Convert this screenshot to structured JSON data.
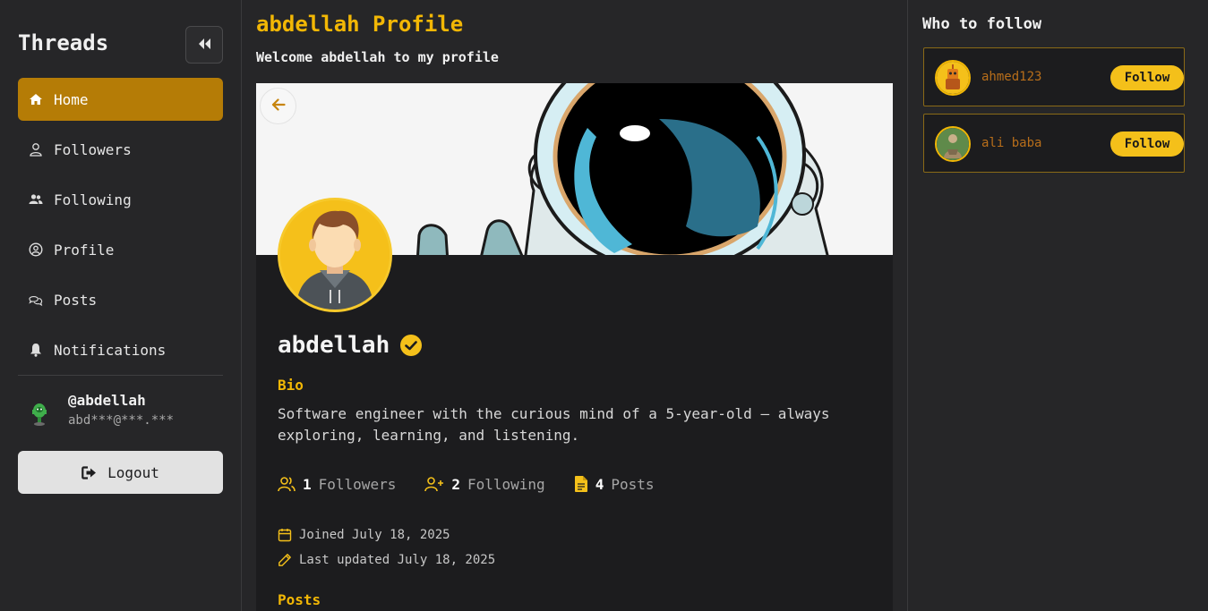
{
  "sidebar": {
    "brand": "Threads",
    "collapse_icon": "double-chevron-left-icon",
    "items": [
      {
        "label": "Home",
        "icon": "home-icon",
        "active": true
      },
      {
        "label": "Followers",
        "icon": "user-icon",
        "active": false
      },
      {
        "label": "Following",
        "icon": "users-icon",
        "active": false
      },
      {
        "label": "Profile",
        "icon": "user-circle-icon",
        "active": false
      },
      {
        "label": "Posts",
        "icon": "chat-icon",
        "active": false
      },
      {
        "label": "Notifications",
        "icon": "bell-icon",
        "active": false
      }
    ],
    "user": {
      "handle": "@abdellah",
      "email": "abd***@***.***"
    },
    "logout_label": "Logout"
  },
  "main": {
    "title": "abdellah Profile",
    "subtitle": "Welcome abdellah to my profile",
    "profile": {
      "name": "abdellah",
      "bio_label": "Bio",
      "bio": "Software engineer with the curious mind of a 5-year-old — always exploring, learning, and listening.",
      "stats": [
        {
          "value": "1",
          "label": "Followers",
          "icon": "users-icon"
        },
        {
          "value": "2",
          "label": "Following",
          "icon": "user-plus-icon"
        },
        {
          "value": "4",
          "label": "Posts",
          "icon": "document-icon"
        }
      ],
      "joined": "Joined July 18, 2025",
      "updated": "Last updated July 18, 2025",
      "posts_heading": "Posts"
    }
  },
  "right": {
    "title": "Who to follow",
    "suggestions": [
      {
        "name": "ahmed123",
        "button": "Follow"
      },
      {
        "name": "ali baba",
        "button": "Follow"
      }
    ]
  },
  "colors": {
    "accent": "#f2b705",
    "active_nav": "#b57c06",
    "background": "#262628",
    "card": "#1c1c1e"
  }
}
